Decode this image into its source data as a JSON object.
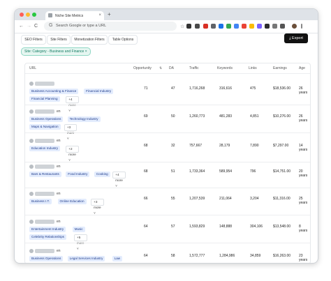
{
  "browser": {
    "tab_title": "Niche Site Metrics",
    "tab_close": "×",
    "new_tab": "+",
    "search_placeholder": "Search Google or type a URL",
    "back": "←",
    "forward": "→",
    "reload": "C",
    "google_g": "G",
    "star": "☆"
  },
  "toolbar": {
    "tabs": [
      "SEO Filters",
      "Site Filters",
      "Monetization Filters",
      "Table Options"
    ],
    "export_label": "Export",
    "filter_chip": "Site: Category - Business and Finance ×"
  },
  "table": {
    "headers": [
      "URL",
      "Opportunity",
      "DA",
      "Traffic",
      "Keywords",
      "Links",
      "Earnings",
      "Age"
    ],
    "rows": [
      {
        "url_suffix": "",
        "tags_line1": [
          "Business Accounting & Finance",
          "Financial Industry"
        ],
        "tags_line2": [
          "Financial Planning"
        ],
        "more": "+4 more",
        "opportunity": "71",
        "da": "47",
        "traffic": "1,716,268",
        "keywords": "316,616",
        "links": "475",
        "earnings": "$18,536.00",
        "age": "26 years"
      },
      {
        "url_suffix": "en",
        "tags_line1": [
          "Business Operations",
          "Technology Industry"
        ],
        "tags_line2": [
          "Maps & Navigation"
        ],
        "more": "+3 more",
        "opportunity": "69",
        "da": "50",
        "traffic": "1,260,773",
        "keywords": "481,283",
        "links": "4,851",
        "earnings": "$10,276.00",
        "age": "26 years"
      },
      {
        "url_suffix": "en",
        "tags_line1": [
          "Education Industry"
        ],
        "tags_line2": [],
        "more": "+2 more",
        "opportunity": "68",
        "da": "32",
        "traffic": "757,667",
        "keywords": "28,179",
        "links": "7,890",
        "earnings": "$7,297.00",
        "age": "14 years"
      },
      {
        "url_suffix": "en",
        "tags_line1": [
          "Bars & Restaurants",
          "Food Industry",
          "Cooking"
        ],
        "tags_line2": [],
        "more": "+4 more",
        "opportunity": "68",
        "da": "51",
        "traffic": "1,733,364",
        "keywords": "589,954",
        "links": "796",
        "earnings": "$14,751.00",
        "age": "20 years"
      },
      {
        "url_suffix": "en",
        "tags_line1": [
          "Business I.T.",
          "Online Education"
        ],
        "tags_line2": [],
        "more": "+3 more",
        "opportunity": "66",
        "da": "55",
        "traffic": "1,207,539",
        "keywords": "211,064",
        "links": "3,204",
        "earnings": "$11,316.00",
        "age": "25 years"
      },
      {
        "url_suffix": "en",
        "tags_line1": [
          "Entertainment Industry",
          "Music"
        ],
        "tags_line2": [
          "Celebrity Relationships"
        ],
        "more": "+5 more",
        "opportunity": "64",
        "da": "57",
        "traffic": "1,593,829",
        "keywords": "148,888",
        "links": "304,106",
        "earnings": "$13,548.00",
        "age": "8 years"
      },
      {
        "url_suffix": "en",
        "tags_line1": [
          "Business Operations",
          "Legal Services Industry",
          "Law"
        ],
        "tags_line2": [],
        "more": "",
        "opportunity": "64",
        "da": "58",
        "traffic": "1,572,777",
        "keywords": "1,284,986",
        "links": "34,859",
        "earnings": "$16,263.00",
        "age": "23 years"
      }
    ]
  },
  "colors": {
    "accent_dark": "#111111",
    "chip_bg": "#e6f6f1",
    "chip_text": "#0f7a60",
    "tag_bg": "#e3ecfd",
    "tag_text": "#1d3a8a"
  },
  "icons": [
    "sort-icon",
    "download-icon",
    "link-icon",
    "chevron-down-icon"
  ]
}
